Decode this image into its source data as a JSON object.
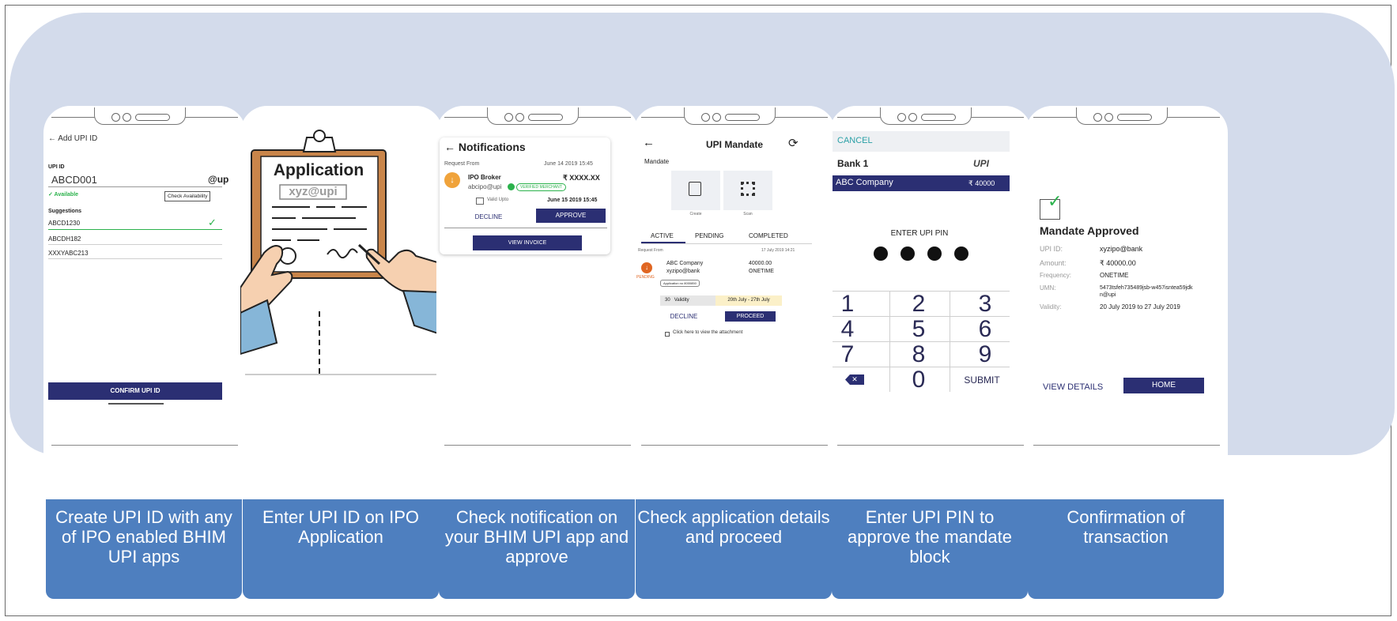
{
  "captions": [
    "Create UPI ID with any of IPO enabled BHIM UPI apps",
    "Enter UPI ID on IPO Application",
    "Check notification on your BHIM UPI app and approve",
    "Check application details and proceed",
    "Enter UPI PIN to approve the mandate block",
    "Confirmation of transaction"
  ],
  "screen1": {
    "back_title": "← Add UPI ID",
    "upi_label": "UPI ID",
    "upi_value": "ABCD001",
    "upi_suffix": "@up",
    "available": "✓ Available",
    "check_btn": "Check Availability",
    "suggestions_label": "Suggestions",
    "suggestions": [
      "ABCD1230",
      "ABCDH182",
      "XXXYABC213"
    ],
    "confirm": "CONFIRM UPI ID"
  },
  "screen2": {
    "title": "Application",
    "upi_text": "xyz@upi"
  },
  "screen3": {
    "title": "← Notifications",
    "request_from": "Request From",
    "date": "June 14 2019 15:45",
    "payee": "IPO Broker",
    "amount": "₹ XXXX.XX",
    "vpa": "abcipo@upi",
    "verified": "VERIFIED MERCHANT",
    "valid_label": "Valid Upto",
    "valid_date": "June 15 2019 15:45",
    "decline": "DECLINE",
    "approve": "APPROVE",
    "view_invoice": "VIEW INVOICE"
  },
  "screen4": {
    "back": "←",
    "title": "UPI Mandate",
    "refresh": "⟳",
    "mandate": "Mandate",
    "create": "Create",
    "scan": "Scan",
    "tabs": [
      "ACTIVE",
      "PENDING",
      "COMPLETED"
    ],
    "request_from": "Request From",
    "date": "17 July 2019 14:21",
    "company": "ABC Company",
    "vpa": "xyzipo@bank",
    "amount": "40000.00",
    "frequency": "ONETIME",
    "status": "PENDING",
    "app_no": "Application no 8000850",
    "validity_days": "30",
    "validity_label": "Validity",
    "validity_range": "20th July - 27th July",
    "decline": "DECLINE",
    "proceed": "PROCEED",
    "attachment": "Click here to view the attachment"
  },
  "screen5": {
    "cancel": "CANCEL",
    "bank": "Bank 1",
    "upi_logo": "UPI",
    "payee": "ABC Company",
    "amount": "₹ 40000",
    "enter_pin": "ENTER UPI PIN",
    "keys": [
      "1",
      "2",
      "3",
      "4",
      "5",
      "6",
      "7",
      "8",
      "9",
      "✕",
      "0",
      "SUBMIT"
    ]
  },
  "screen6": {
    "title": "Mandate Approved",
    "rows": [
      {
        "label": "UPI ID:",
        "value": "xyzipo@bank"
      },
      {
        "label": "Amount:",
        "value": "₹ 40000.00"
      },
      {
        "label": "Frequency:",
        "value": "ONETIME"
      },
      {
        "label": "UMN:",
        "value": "5473tsfeh735489jsb-w457isntea59jdkn@upi"
      },
      {
        "label": "Validity:",
        "value": "20 July 2019 to 27 July 2019"
      }
    ],
    "view_details": "VIEW DETAILS",
    "home": "HOME"
  },
  "colors": {
    "band": "#d3dbeb",
    "caption": "#4e7fbf",
    "navy": "#2b2f73",
    "teal": "#2aa0a6",
    "green": "#2bb24c",
    "orange": "#f0a33b"
  }
}
